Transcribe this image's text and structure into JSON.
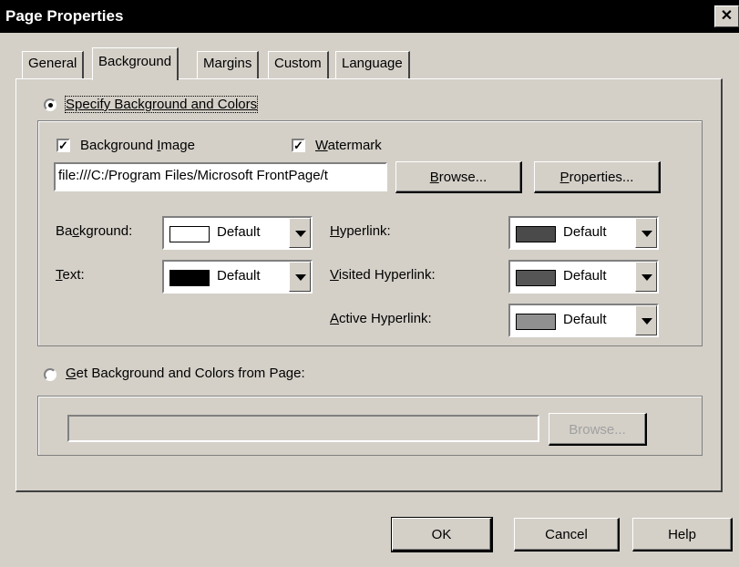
{
  "window": {
    "title": "Page Properties",
    "close_glyph": "✕"
  },
  "tabs": [
    {
      "label": "General"
    },
    {
      "label": "Background"
    },
    {
      "label": "Margins"
    },
    {
      "label": "Custom"
    },
    {
      "label": "Language"
    }
  ],
  "specify": {
    "label": "Specify Background and Colors",
    "selected": true
  },
  "background_image": {
    "label_pre": "Background ",
    "label_u": "I",
    "label_post": "mage",
    "checked": true,
    "check_glyph": "✓"
  },
  "watermark": {
    "label_u": "W",
    "label_post": "atermark",
    "checked": true,
    "check_glyph": "✓"
  },
  "image_path": {
    "value": "file:///C:/Program Files/Microsoft FrontPage/t"
  },
  "browse_button": {
    "label_u": "B",
    "label_post": "rowse..."
  },
  "properties_button": {
    "label_u": "P",
    "label_post": "roperties..."
  },
  "colors": {
    "background": {
      "label_pre": "Ba",
      "label_u": "c",
      "label_post": "kground:",
      "value": "Default",
      "swatch": "#ffffff"
    },
    "text": {
      "label_u": "T",
      "label_post": "ext:",
      "value": "Default",
      "swatch": "#000000"
    },
    "hyperlink": {
      "label_u": "H",
      "label_post": "yperlink:",
      "value": "Default",
      "swatch": "#4a4a4a"
    },
    "visited_hyperlink": {
      "label_u": "V",
      "label_post": "isited Hyperlink:",
      "value": "Default",
      "swatch": "#555555"
    },
    "active_hyperlink": {
      "label_u": "A",
      "label_post": "ctive Hyperlink:",
      "value": "Default",
      "swatch": "#909090"
    }
  },
  "get_from_page": {
    "label_u": "G",
    "label_post": "et Background and Colors from Page:",
    "selected": false,
    "value": ""
  },
  "page_browse_button": {
    "label": "Browse..."
  },
  "footer": {
    "ok": "OK",
    "cancel": "Cancel",
    "help": "Help"
  }
}
